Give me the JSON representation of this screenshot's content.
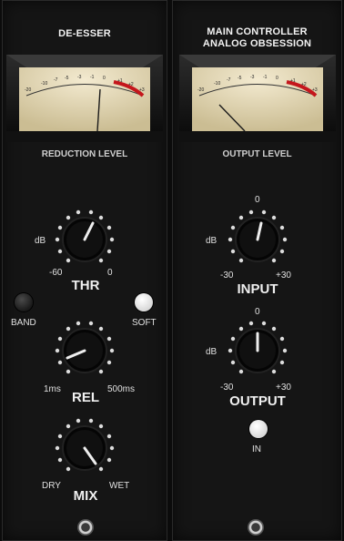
{
  "deesser": {
    "title": "DE-ESSER",
    "meter_label": "REDUCTION LEVEL",
    "thr": {
      "name": "THR",
      "unit": "dB",
      "min": "-60",
      "max": "0"
    },
    "band": {
      "left": "BAND",
      "right": "SOFT"
    },
    "rel": {
      "name": "REL",
      "min": "1ms",
      "max": "500ms"
    },
    "mix": {
      "name": "MIX",
      "min": "DRY",
      "max": "WET"
    }
  },
  "main": {
    "title_line1": "MAIN CONTROLLER",
    "title_line2": "ANALOG OBSESSION",
    "meter_label": "OUTPUT LEVEL",
    "input": {
      "name": "INPUT",
      "unit": "dB",
      "top": "0",
      "min": "-30",
      "max": "+30"
    },
    "output": {
      "name": "OUTPUT",
      "unit": "dB",
      "top": "0",
      "min": "-30",
      "max": "+30"
    },
    "in_label": "IN"
  },
  "vu_scale": [
    "-20",
    "-10",
    "-7",
    "-5",
    "-3",
    "-1",
    "0",
    "+1",
    "+2",
    "+3"
  ],
  "colors": {
    "panel": "#151515",
    "meter_face": "#e6d9b0",
    "red_zone": "#c4161c",
    "led_white": "#ffffff",
    "led_dark": "#2a2a2a"
  }
}
